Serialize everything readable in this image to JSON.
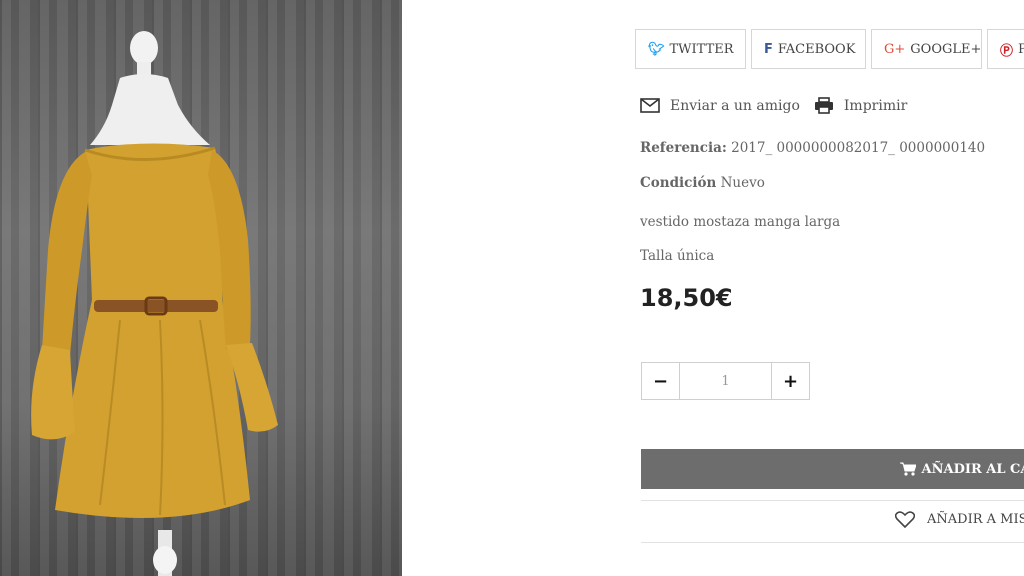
{
  "share": {
    "twitter_label": "TWITTER",
    "facebook_label": "FACEBOOK",
    "google_label": "GOOGLE+",
    "pinterest_label": "P",
    "twitter_icon": "twitter-bird-icon",
    "facebook_icon": "facebook-f-icon",
    "google_icon": "google-plus-icon",
    "pinterest_icon": "pinterest-icon",
    "colors": {
      "twitter": "#1da1f2",
      "facebook": "#3b5998",
      "google": "#dd4b39",
      "pinterest": "#cb2027"
    }
  },
  "actions": {
    "send_friend_label": "Enviar a un amigo",
    "print_label": "Imprimir"
  },
  "product": {
    "reference_label": "Referencia:",
    "reference_value": "2017_ 0000000082017_ 0000000140",
    "condition_label": "Condición",
    "condition_value": "Nuevo",
    "description": "vestido mostaza manga larga",
    "size": "Talla única",
    "price": "18,50€",
    "image_description_icon": "product-photo"
  },
  "quantity": {
    "value": "1",
    "minus_label": "−",
    "plus_label": "+"
  },
  "cart": {
    "add_to_cart_label": "AÑADIR AL CA",
    "wishlist_label": "AÑADIR A MIS",
    "button_color": "#6d6d6d"
  }
}
